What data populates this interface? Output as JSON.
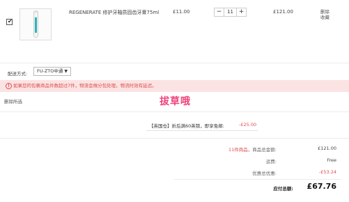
{
  "product": {
    "name": "REGENERATE 修护牙釉质固齿牙膏75ml",
    "unit_price": "£11.00",
    "quantity": "11",
    "qty_minus": "−",
    "qty_plus": "+",
    "subtotal": "£121.00",
    "action_delete": "删除",
    "action_favorite": "收藏",
    "checked_mark": "✔",
    "accent_color": "#2bb3b8"
  },
  "shipping": {
    "label": "配送方式:",
    "selected": "FU-ZTO中通",
    "arrow": "▼"
  },
  "warning": {
    "icon": "!",
    "text": "如果您的包裹商品件数超过7件，物流会做分包处理，物流时效有延迟。",
    "color": "#e04a4a"
  },
  "delete_selected": "删除所选",
  "watermark": "拔草哦",
  "promo": {
    "text": "【英国仓】折后满60英镑，即享免邮:",
    "amount": "-£25.00"
  },
  "summary": {
    "items_count": "11件商品，",
    "items_label": "商品总金额:",
    "items_total": "£121.00",
    "shipping_label": "运费:",
    "shipping_value": "Free",
    "discount_label": "优惠总优惠:",
    "discount_value": "-£53.24",
    "total_label": "应付总额:",
    "total_value": "£67.76"
  }
}
